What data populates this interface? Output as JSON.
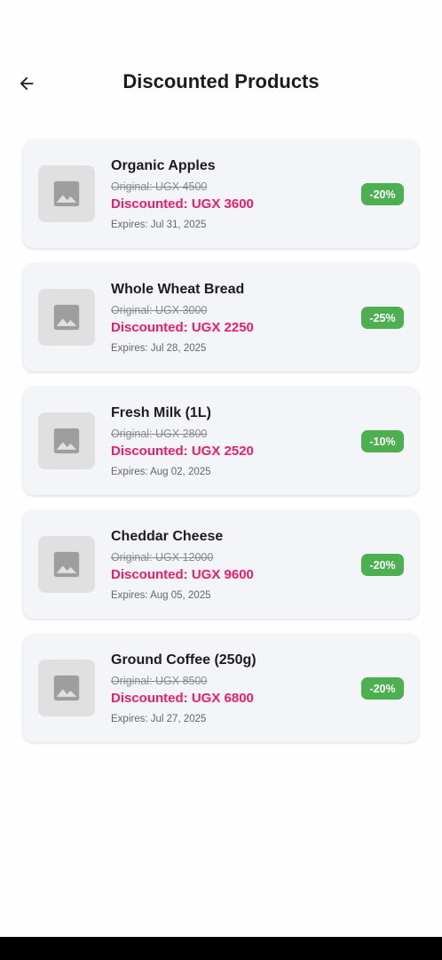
{
  "header": {
    "title": "Discounted Products",
    "back_icon": "arrow-left-icon"
  },
  "products": [
    {
      "name": "Organic Apples",
      "original": "Original: UGX 4500",
      "discounted": "Discounted: UGX 3600",
      "expires": "Expires: Jul 31, 2025",
      "badge": "-20%"
    },
    {
      "name": "Whole Wheat Bread",
      "original": "Original: UGX 3000",
      "discounted": "Discounted: UGX 2250",
      "expires": "Expires: Jul 28, 2025",
      "badge": "-25%"
    },
    {
      "name": "Fresh Milk (1L)",
      "original": "Original: UGX 2800",
      "discounted": "Discounted: UGX 2520",
      "expires": "Expires: Aug 02, 2025",
      "badge": "-10%"
    },
    {
      "name": "Cheddar Cheese",
      "original": "Original: UGX 12000",
      "discounted": "Discounted: UGX 9600",
      "expires": "Expires: Aug 05, 2025",
      "badge": "-20%"
    },
    {
      "name": "Ground Coffee (250g)",
      "original": "Original: UGX 8500",
      "discounted": "Discounted: UGX 6800",
      "expires": "Expires: Jul 27, 2025",
      "badge": "-20%"
    }
  ],
  "colors": {
    "discount": "#e91e63",
    "badge": "#4caf50",
    "card": "#f4f5f9"
  }
}
